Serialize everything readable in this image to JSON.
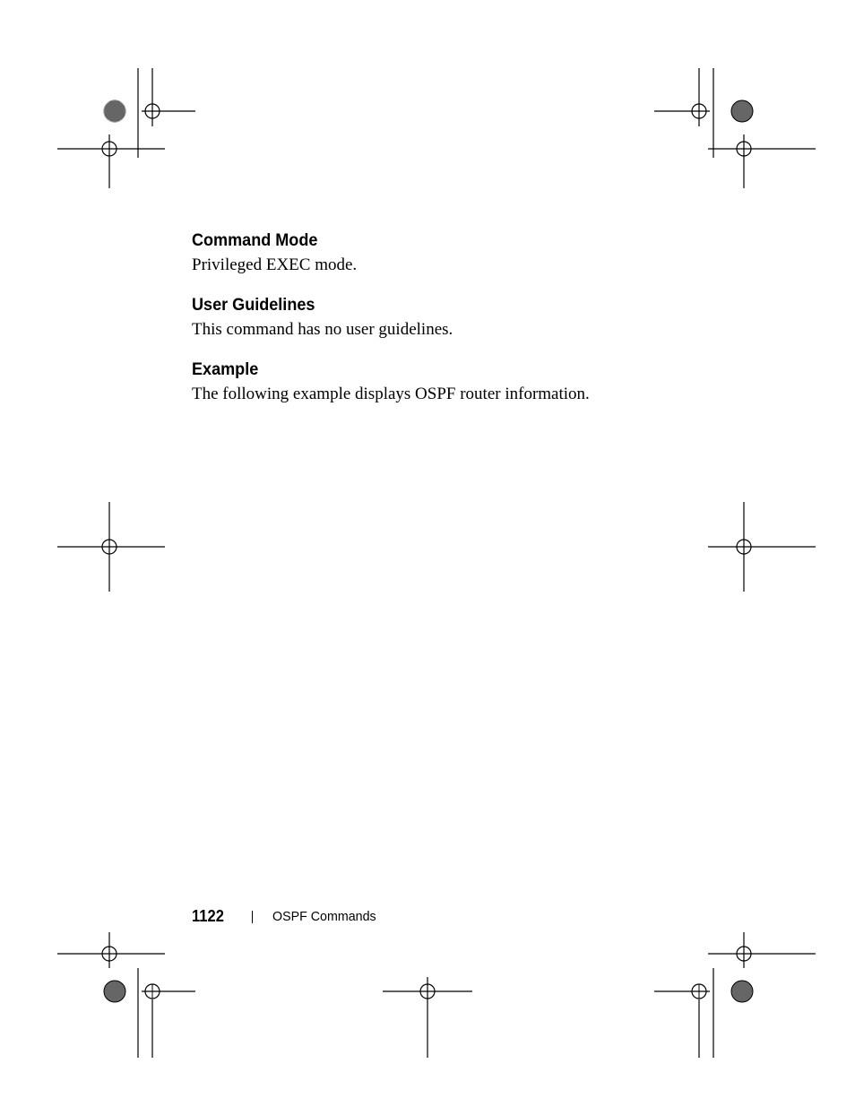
{
  "sections": {
    "command_mode": {
      "heading": "Command Mode",
      "body": "Privileged EXEC mode."
    },
    "user_guidelines": {
      "heading": "User Guidelines",
      "body": "This command has no user guidelines."
    },
    "example": {
      "heading": "Example",
      "body": "The following example displays OSPF router information."
    }
  },
  "footer": {
    "page_number": "1122",
    "section_title": "OSPF Commands"
  }
}
